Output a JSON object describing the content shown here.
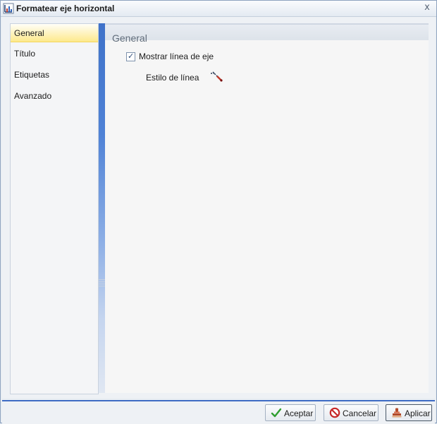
{
  "window": {
    "title": "Formatear eje horizontal",
    "close_glyph": "x"
  },
  "nav": {
    "items": [
      {
        "label": "General",
        "selected": true
      },
      {
        "label": "Título",
        "selected": false
      },
      {
        "label": "Etiquetas",
        "selected": false
      },
      {
        "label": "Avanzado",
        "selected": false
      }
    ]
  },
  "content": {
    "section_title": "General",
    "show_axis_line": {
      "label": "Mostrar línea de eje",
      "checked": true
    },
    "line_style": {
      "label": "Estilo de línea",
      "icon": "line-style-icon"
    }
  },
  "footer": {
    "accept_label": "Aceptar",
    "cancel_label": "Cancelar",
    "apply_label": "Aplicar"
  },
  "colors": {
    "accent": "#3e6bc4",
    "selected_item": "#fde98c"
  }
}
